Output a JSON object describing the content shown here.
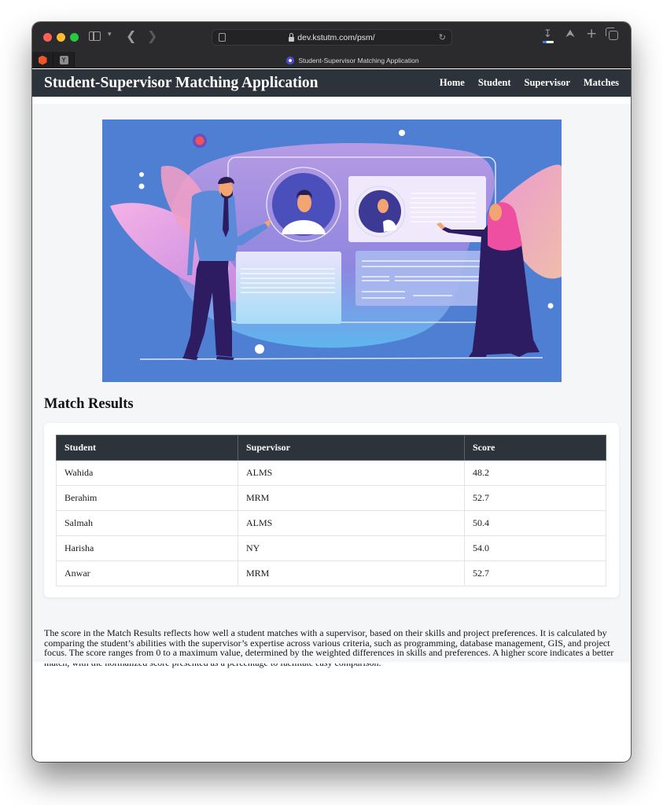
{
  "browser": {
    "url": "dev.kstutm.com/psm/",
    "active_tab_title": "Student-Supervisor Matching Application",
    "pinned_tabs": [
      {
        "icon": "hexagon-app-icon"
      },
      {
        "icon": "y-letter-icon",
        "letter": "Y"
      }
    ],
    "toolbar_icons": [
      "sidebar-icon",
      "chevron-down-icon",
      "back-icon",
      "forward-icon",
      "reader-icon",
      "lock-icon",
      "reload-icon",
      "download-icon",
      "share-icon",
      "plus-icon",
      "tabs-overview-icon"
    ],
    "download_progress": 0.35
  },
  "navbar": {
    "brand": "Student-Supervisor Matching Application",
    "links": [
      {
        "label": "Home"
      },
      {
        "label": "Student"
      },
      {
        "label": "Supervisor"
      },
      {
        "label": "Matches"
      }
    ]
  },
  "hero": {
    "alt": "Illustration of a man and a woman presenting profile cards on a large screen"
  },
  "match_results": {
    "title": "Match Results",
    "columns": [
      "Student",
      "Supervisor",
      "Score"
    ],
    "rows": [
      {
        "student": "Wahida",
        "supervisor": "ALMS",
        "score": "48.2"
      },
      {
        "student": "Berahim",
        "supervisor": "MRM",
        "score": "52.7"
      },
      {
        "student": "Salmah",
        "supervisor": "ALMS",
        "score": "50.4"
      },
      {
        "student": "Harisha",
        "supervisor": "NY",
        "score": "54.0"
      },
      {
        "student": "Anwar",
        "supervisor": "MRM",
        "score": "52.7"
      }
    ]
  },
  "explanation": "The score in the Match Results reflects how well a student matches with a supervisor, based on their skills and project preferences. It is calculated by comparing the student’s abilities with the supervisor’s expertise across various criteria, such as programming, database management, GIS, and project focus. The score ranges from 0 to a maximum value, determined by the weighted differences in skills and preferences. A higher score indicates a better match, with the normalized score presented as a percentage to facilitate easy comparison.",
  "colors": {
    "navbar_bg": "#2c333a",
    "table_header_bg": "#2c333a",
    "page_bg": "#f5f6f8",
    "hero_bg": "#4e7fd2"
  }
}
